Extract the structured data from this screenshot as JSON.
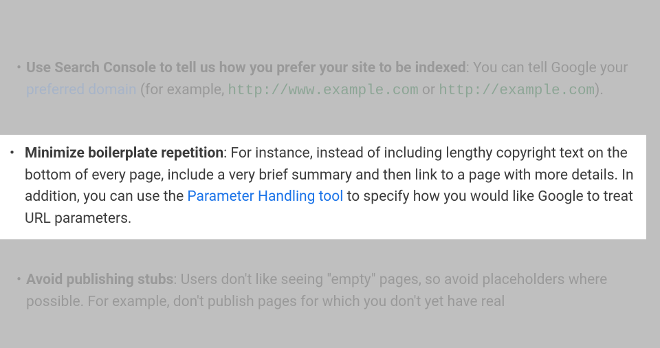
{
  "item1": {
    "bold": "Use Search Console to tell us how you prefer your site to be indexed",
    "afterBold": ": You can tell Google your ",
    "link": "preferred domain",
    "afterLink": " (for example, ",
    "mono1": "http://www.example.com",
    "betweenMono": " or ",
    "mono2": "http://example.com",
    "afterMono": ")."
  },
  "item2": {
    "bold": "Minimize boilerplate repetition",
    "afterBold": ": For instance, instead of including lengthy copyright text on the bottom of every page, include a very brief summary and then link to a page with more details. In addition, you can use the ",
    "link": "Parameter Handling tool",
    "afterLink": " to specify how you would like Google to treat URL parameters."
  },
  "item3": {
    "bold": "Avoid publishing stubs",
    "afterBold": ": Users don't like seeing \"empty\" pages, so avoid placeholders where possible. For example, don't publish pages for which you don't yet have real"
  }
}
